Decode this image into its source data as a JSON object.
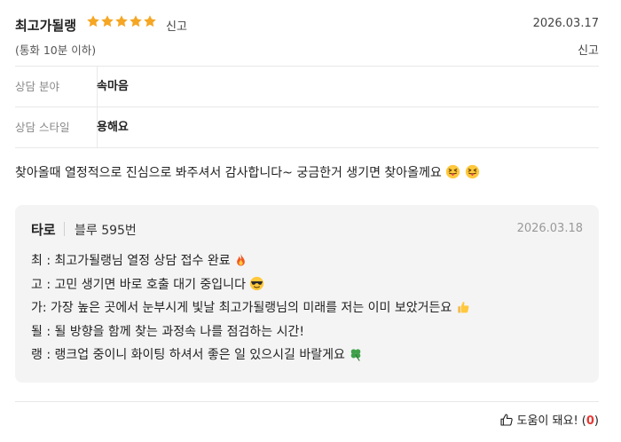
{
  "review": {
    "nickname": "최고가될랭",
    "rating": 5,
    "report_label": "신고",
    "date": "2026.03.17",
    "call_type": "(통화 10분 이하)",
    "sub_report_label": "신고",
    "info": [
      {
        "label": "상담 분야",
        "value": "속마음"
      },
      {
        "label": "상담 스타일",
        "value": "용해요"
      }
    ],
    "content": "찾아올때 열정적으로 진심으로 봐주셔서 감사합니다~ 궁금한거 생기면 찾아올께요",
    "content_emojis": [
      "squint-tongue-emoji",
      "squint-tongue-emoji"
    ]
  },
  "reply": {
    "name": "타로",
    "counselor_code": "블루 595번",
    "date": "2026.03.18",
    "lines": [
      {
        "text": "최 : 최고가될랭님 열정 상담 접수 완료",
        "emoji": "fire-emoji"
      },
      {
        "text": "고 : 고민 생기면 바로 호출 대기 중입니다",
        "emoji": "sunglasses-emoji"
      },
      {
        "text": "가: 가장 높은 곳에서 눈부시게 빛날 최고가될랭님의 미래를 저는 이미 보았거든요",
        "emoji": "thumbs-up-emoji"
      },
      {
        "text": "될 : 될 방향을 함께 찾는 과정속 나를 점검하는 시간!",
        "emoji": ""
      },
      {
        "text": "랭 : 랭크업 중이니 화이팅 하셔서 좋은 일 있으시길 바랄게요",
        "emoji": "four-leaf-clover-emoji"
      }
    ]
  },
  "helpful": {
    "label": "도움이 돼요! (",
    "count": "0",
    "close": ")"
  },
  "colors": {
    "star": "#f5a623",
    "count": "#e53935",
    "reply_bg": "#f4f4f4"
  }
}
